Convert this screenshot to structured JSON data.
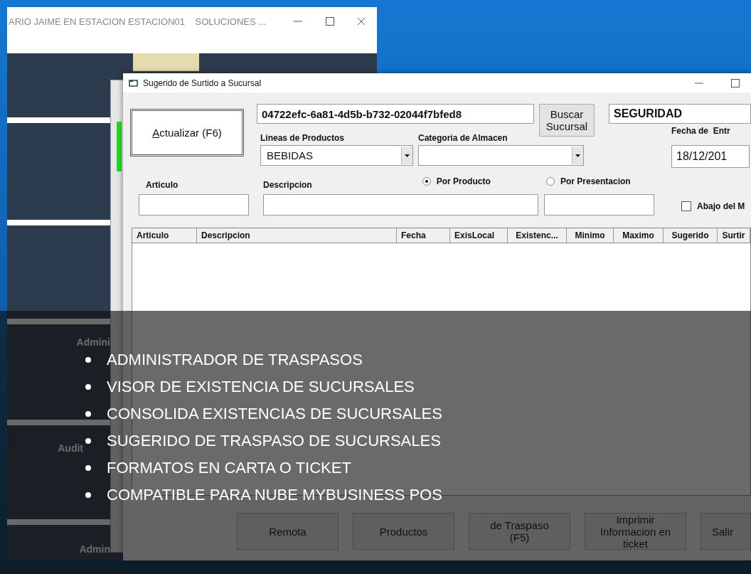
{
  "back_window": {
    "title": "ARIO JAIME EN ESTACION ESTACION01    SOLUCIONES ...",
    "tiles": [
      "Admini",
      "Audit",
      "Admin"
    ]
  },
  "dialog": {
    "title": "Sugerido de Surtido a Sucursal",
    "update_button": "Actualizar (F6)",
    "branch_id": "04722efc-6a81-4d5b-b732-02044f7bfed8",
    "search_button": "Buscar Sucursal",
    "branch_name": "SEGURIDAD",
    "product_line": {
      "label": "Lineas de Productos",
      "value": "BEBIDAS"
    },
    "category": {
      "label": "Categoria de Almacen"
    },
    "date": {
      "label": "Fecha de  Entr",
      "value": "18/12/201"
    },
    "article_label": "Articulo",
    "description_label": "Descripcion",
    "modes": [
      {
        "label": "Por Producto",
        "selected": true
      },
      {
        "label": "Por Presentacion",
        "selected": false
      }
    ],
    "below_min": {
      "label": "Abajo del M",
      "checked": false
    },
    "table": {
      "columns": [
        "Articulo",
        "Descripcion",
        "Fecha",
        "ExisLocal",
        "Existenc...",
        "Minimo",
        "Maximo",
        "Sugerido",
        "Surtir"
      ]
    },
    "buttons": [
      "Remota",
      "Productos",
      "de Traspaso (F5)",
      "Imprimir Informacion en ticket",
      "Salir"
    ]
  },
  "overlay": {
    "items": [
      "ADMINISTRADOR DE TRASPASOS",
      "VISOR DE EXISTENCIA DE SUCURSALES",
      "CONSOLIDA EXISTENCIAS DE SUCURSALES",
      "SUGERIDO DE TRASPASO DE SUCURSALES",
      "FORMATOS EN CARTA O TICKET",
      "COMPATIBLE PARA NUBE MYBUSINESS POS"
    ]
  }
}
